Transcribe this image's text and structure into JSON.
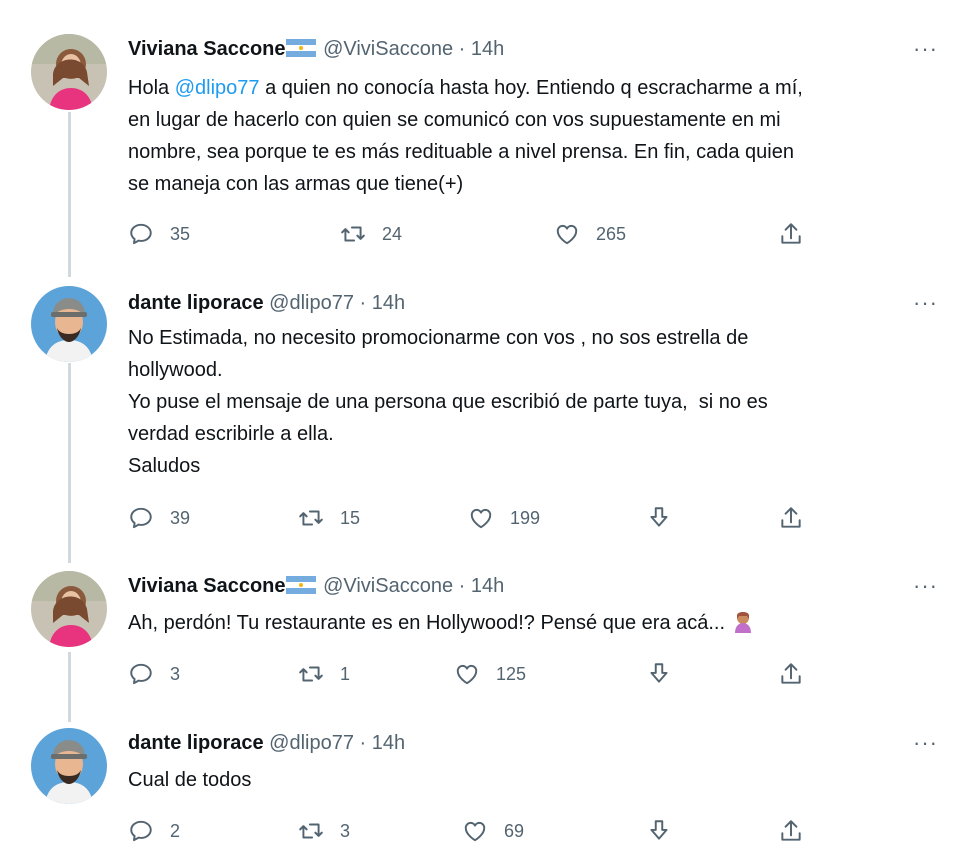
{
  "thread": [
    {
      "name": "Viviana Saccone",
      "handle": "@ViviSaccone",
      "time": "14h",
      "body_prefix": "Hola ",
      "mention": "@dlipo77",
      "body_suffix": " a quien no conocía hasta hoy. Entiendo q escracharme a mí,\nen lugar de hacerlo con quien se comunicó con vos supuestamente en mi\nnombre, sea porque te es más redituable a nivel prensa. En fin, cada quien\nse maneja con las armas que tiene(+)",
      "replies": "35",
      "retweets": "24",
      "likes": "265"
    },
    {
      "name": "dante liporace",
      "handle": "@dlipo77",
      "time": "14h",
      "body": "No Estimada, no necesito promocionarme con vos , no sos estrella de\nhollywood.\nYo puse el mensaje de una persona que escribió de parte tuya,  si no es\nverdad escribirle a ella.\nSaludos",
      "replies": "39",
      "retweets": "15",
      "likes": "199"
    },
    {
      "name": "Viviana Saccone",
      "handle": "@ViviSaccone",
      "time": "14h",
      "body": "Ah, perdón! Tu restaurante es en Hollywood!? Pensé que era acá...",
      "replies": "3",
      "retweets": "1",
      "likes": "125"
    },
    {
      "name": "dante liporace",
      "handle": "@dlipo77",
      "time": "14h",
      "body": "Cual de todos",
      "replies": "2",
      "retweets": "3",
      "likes": "69"
    }
  ],
  "separator": " · ",
  "more_label": "···",
  "colors": {
    "link": "#1d9bf0",
    "text": "#0f1419",
    "muted": "#536471",
    "thread_line": "#cfd9de"
  }
}
